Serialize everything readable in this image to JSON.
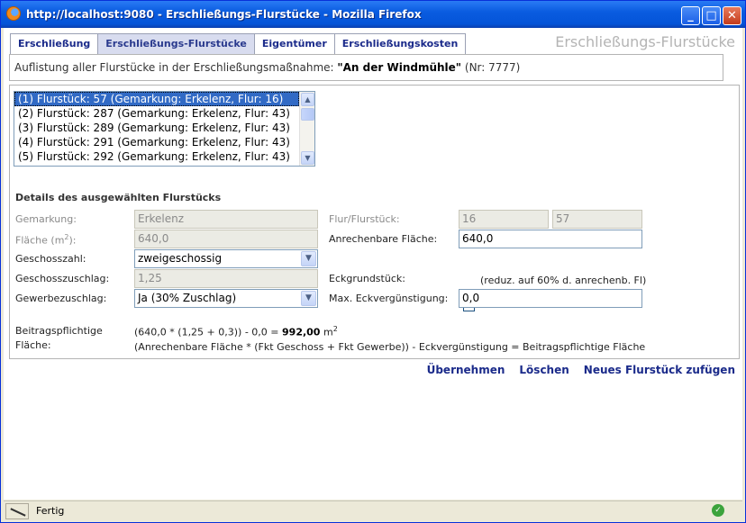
{
  "window": {
    "title": "http://localhost:9080 - Erschließungs-Flurstücke - Mozilla Firefox",
    "minimize_glyph": "_",
    "maximize_glyph": "□",
    "close_glyph": "✕"
  },
  "tabs": [
    {
      "label": "Erschließung"
    },
    {
      "label": "Erschließungs-Flurstücke",
      "active": true
    },
    {
      "label": "Eigentümer"
    },
    {
      "label": "Erschließungskosten"
    }
  ],
  "page_heading": "Erschließungs-Flurstücke",
  "summary": {
    "prefix": "Auflistung aller Flurstücke in der Erschließungsmaßnahme:",
    "measure": "\"An der Windmühle\"",
    "suffix": "(Nr: 7777)"
  },
  "plot_list": [
    "(1) Flurstück: 57 (Gemarkung: Erkelenz, Flur: 16)",
    "(2) Flurstück: 287 (Gemarkung: Erkelenz, Flur: 43)",
    "(3) Flurstück: 289 (Gemarkung: Erkelenz, Flur: 43)",
    "(4) Flurstück: 291 (Gemarkung: Erkelenz, Flur: 43)",
    "(5) Flurstück: 292 (Gemarkung: Erkelenz, Flur: 43)"
  ],
  "details": {
    "title": "Details des ausgewählten Flurstücks",
    "gemarkung_label": "Gemarkung:",
    "gemarkung_value": "Erkelenz",
    "flaeche_label": "Fläche (m",
    "flaeche_sup": "2",
    "flaeche_label_end": "):",
    "flaeche_value": "640,0",
    "geschosszahl_label": "Geschosszahl:",
    "geschosszahl_value": "zweigeschossig",
    "geschosszuschlag_label": "Geschosszuschlag:",
    "geschosszuschlag_value": "1,25",
    "gewerbezuschlag_label": "Gewerbezuschlag:",
    "gewerbezuschlag_value": "Ja (30% Zuschlag)",
    "flur_label": "Flur/Flurstück:",
    "flur_value": "16",
    "flurstueck_value": "57",
    "anrechenbar_label": "Anrechenbare Fläche:",
    "anrechenbar_value": "640,0",
    "eck_label": "Eckgrundstück:",
    "eck_hint": "(reduz. auf 60% d. anrechenb. Fl)",
    "max_eck_label": "Max. Eckvergünstigung:",
    "max_eck_value": "0,0",
    "beitrag_label_1": "Beitragspflichtige",
    "beitrag_label_2": "Fläche:",
    "formula": "(640,0 * (1,25 + 0,3)) - 0,0 =",
    "formula_result": "992,00",
    "formula_unit": "m",
    "formula_sup": "2",
    "formula_explain": "(Anrechenbare Fläche * (Fkt Geschoss + Fkt Gewerbe)) - Eckvergünstigung = Beitragspflichtige Fläche"
  },
  "actions": {
    "apply": "Übernehmen",
    "delete": "Löschen",
    "new": "Neues Flurstück zufügen"
  },
  "status": {
    "text": "Fertig"
  },
  "icons": {
    "browser": "firefox-icon",
    "status": "network-activity-icon",
    "ok": "ok-icon"
  }
}
